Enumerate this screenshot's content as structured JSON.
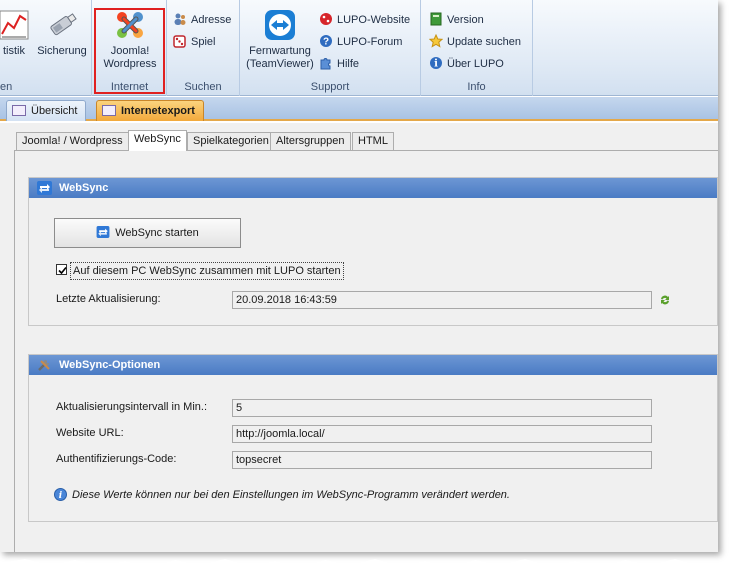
{
  "ribbon": {
    "groups": [
      {
        "label": "en",
        "buttons": [
          {
            "label": "tistik"
          },
          {
            "label": "Sicherung"
          }
        ]
      },
      {
        "label": "Internet",
        "buttons": [
          {
            "label": "Joomla! Wordpress"
          }
        ]
      },
      {
        "label": "Suchen",
        "buttons": [
          {
            "label": "Adresse"
          },
          {
            "label": "Spiel"
          }
        ]
      },
      {
        "label": "Support",
        "buttons": [
          {
            "label": "Fernwartung (TeamViewer)"
          },
          {
            "label": "LUPO-Website"
          },
          {
            "label": "LUPO-Forum"
          },
          {
            "label": "Hilfe"
          }
        ]
      },
      {
        "label": "Info",
        "buttons": [
          {
            "label": "Version"
          },
          {
            "label": "Update suchen"
          },
          {
            "label": "Über LUPO"
          }
        ]
      }
    ]
  },
  "doc_tabs": [
    {
      "label": "Übersicht",
      "active": false
    },
    {
      "label": "Internetexport",
      "active": true
    }
  ],
  "sub_tabs": [
    {
      "label": "Joomla! / Wordpress",
      "active": false
    },
    {
      "label": "WebSync",
      "active": true
    },
    {
      "label": "Spielkategorien",
      "active": false
    },
    {
      "label": "Altersgruppen",
      "active": false
    },
    {
      "label": "HTML",
      "active": false
    }
  ],
  "websync": {
    "title": "WebSync",
    "start_button": "WebSync starten",
    "autostart_label": "Auf diesem PC WebSync zusammen mit LUPO starten",
    "autostart_checked": true,
    "last_update_label": "Letzte Aktualisierung:",
    "last_update_value": "20.09.2018 16:43:59"
  },
  "options": {
    "title": "WebSync-Optionen",
    "interval_label": "Aktualisierungsintervall in Min.:",
    "interval_value": "5",
    "url_label": "Website URL:",
    "url_value": "http://joomla.local/",
    "auth_label": "Authentifizierungs-Code:",
    "auth_value": "topsecret",
    "note": "Diese Werte können nur bei den Einstellungen im WebSync-Programm verändert werden."
  },
  "colors": {
    "section_header": "#5585cc",
    "active_doc_tab": "#f5b24a",
    "highlight_border": "#e02020"
  }
}
